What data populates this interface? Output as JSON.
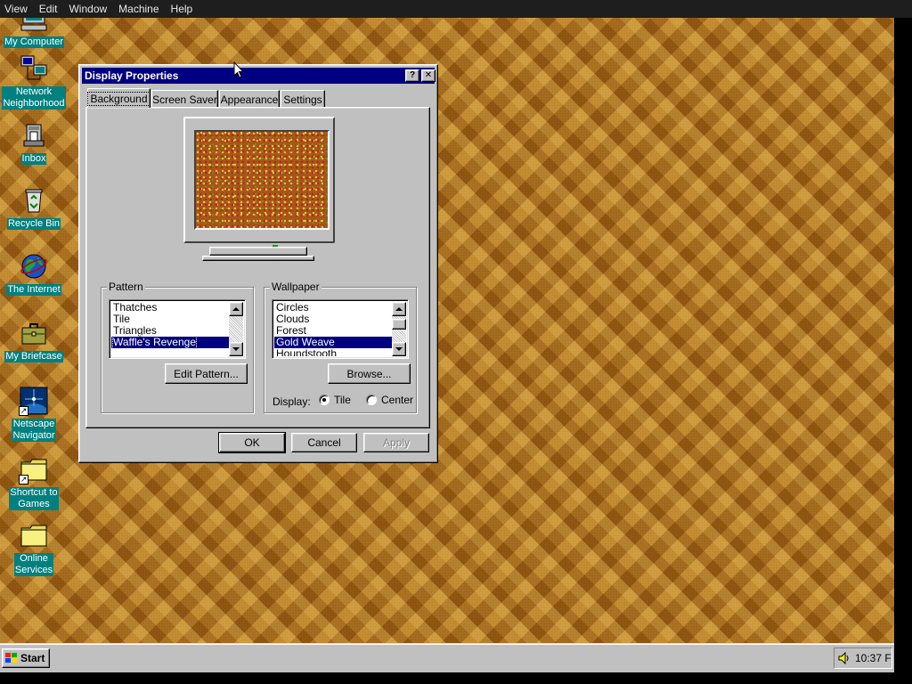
{
  "host_menubar": {
    "items": [
      "View",
      "Edit",
      "Window",
      "Machine",
      "Help"
    ]
  },
  "desktop": {
    "wallpaper_color": "#a86a1a",
    "icons": [
      {
        "label": "My Computer",
        "icon": "computer-icon"
      },
      {
        "label": "Network\nNeighborhood",
        "icon": "network-neighborhood-icon"
      },
      {
        "label": "Inbox",
        "icon": "inbox-icon"
      },
      {
        "label": "Recycle Bin",
        "icon": "recycle-bin-icon"
      },
      {
        "label": "The Internet",
        "icon": "internet-globe-icon"
      },
      {
        "label": "My Briefcase",
        "icon": "briefcase-icon"
      },
      {
        "label": "Netscape\nNavigator",
        "icon": "netscape-navigator-icon"
      },
      {
        "label": "Shortcut to\nGames",
        "icon": "folder-shortcut-icon"
      },
      {
        "label": "Online\nServices",
        "icon": "folder-icon"
      }
    ]
  },
  "dialog": {
    "title": "Display Properties",
    "help_glyph": "?",
    "close_glyph": "✕",
    "tabs": [
      "Background",
      "Screen Saver",
      "Appearance",
      "Settings"
    ],
    "active_tab": "Background",
    "pattern": {
      "legend": "Pattern",
      "items": [
        "Thatches",
        "Tile",
        "Triangles",
        "Waffle's Revenge"
      ],
      "selected": "Waffle's Revenge",
      "edit_button": "Edit Pattern..."
    },
    "wallpaper": {
      "legend": "Wallpaper",
      "items": [
        "Circles",
        "Clouds",
        "Forest",
        "Gold Weave",
        "Houndstooth"
      ],
      "selected": "Gold Weave",
      "browse_button": "Browse...",
      "display_label": "Display:",
      "display_options": [
        "Tile",
        "Center"
      ],
      "display_selected": "Tile"
    },
    "buttons": {
      "ok": "OK",
      "cancel": "Cancel",
      "apply": "Apply"
    }
  },
  "taskbar": {
    "start_label": "Start",
    "clock": "10:37 F",
    "tray_icon": "speaker-icon"
  },
  "colors": {
    "titlebar": "#000080",
    "desktop_label_bg": "#00807f",
    "face": "#c0c0c0",
    "selection": "#000080"
  }
}
